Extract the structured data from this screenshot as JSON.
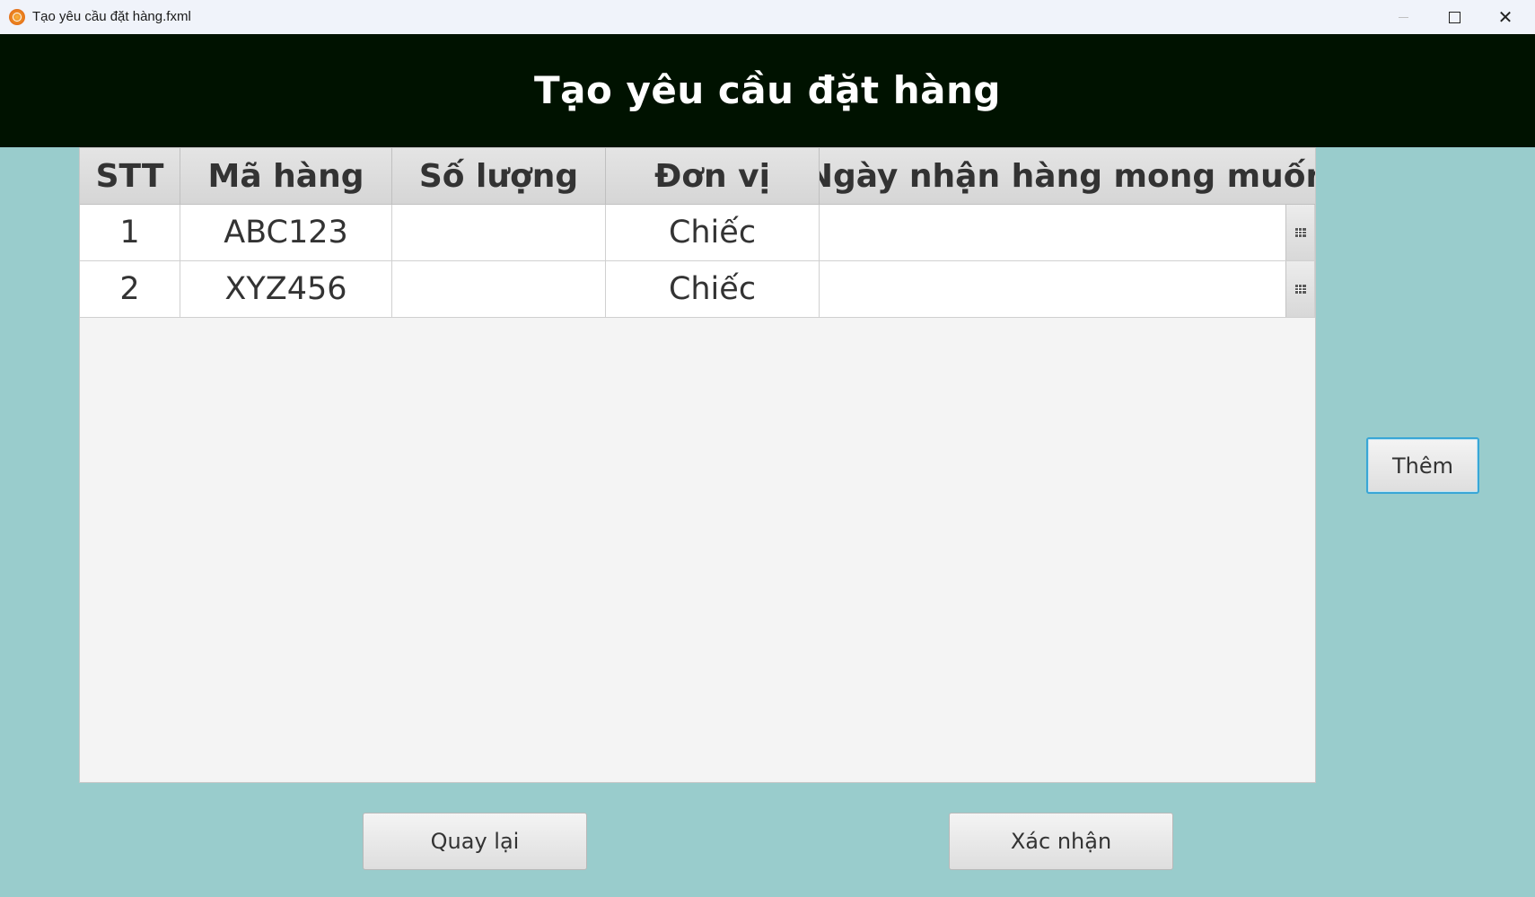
{
  "window": {
    "title": "Tạo yêu cầu đặt hàng.fxml",
    "icon": "app-logo-icon",
    "controls": {
      "minimize": "minimize-icon",
      "maximize": "maximize-icon",
      "close": "close-icon",
      "close_glyph": "✕"
    }
  },
  "header": {
    "title": "Tạo yêu cầu đặt hàng"
  },
  "table": {
    "columns": [
      "STT",
      "Mã hàng",
      "Số lượng",
      "Đơn vị",
      "Ngày nhận hàng mong muốn"
    ],
    "rows": [
      {
        "stt": "1",
        "code": "ABC123",
        "quantity": "",
        "unit": "Chiếc",
        "date": ""
      },
      {
        "stt": "2",
        "code": "XYZ456",
        "quantity": "",
        "unit": "Chiếc",
        "date": ""
      }
    ]
  },
  "buttons": {
    "add": "Thêm",
    "back": "Quay lại",
    "confirm": "Xác nhận"
  },
  "colors": {
    "header_bg": "#001200",
    "content_bg": "#99cccc",
    "accent_focus": "#39a6d6"
  }
}
